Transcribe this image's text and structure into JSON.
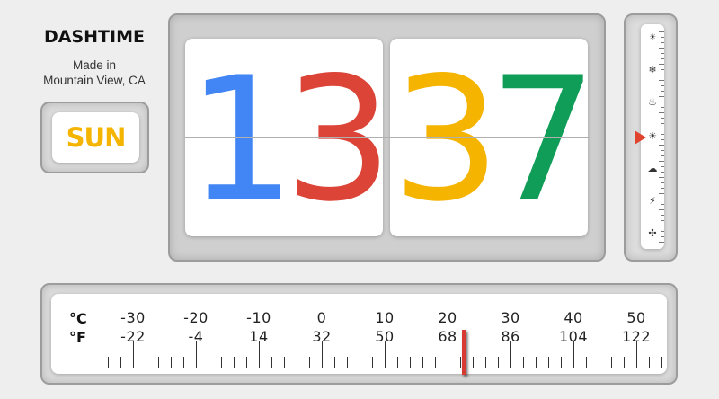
{
  "brand": {
    "title": "DASHTIME",
    "subtitle_line1": "Made in",
    "subtitle_line2": "Mountain View, CA"
  },
  "day": {
    "label": "SUN",
    "color": "#f4b400"
  },
  "clock": {
    "hour": [
      "1",
      "3"
    ],
    "minute": [
      "3",
      "7"
    ],
    "digit_colors": [
      "#4285f4",
      "#db4437",
      "#f4b400",
      "#0f9d58"
    ]
  },
  "weather": {
    "icons": [
      "partly-sunny-icon",
      "snowflake-icon",
      "fire-icon",
      "sun-icon",
      "cloud-icon",
      "lightning-icon",
      "fan-icon"
    ],
    "selected_icon": "sun-icon",
    "pointer_color": "#e0442f"
  },
  "thermometer": {
    "celsius_unit": "°C",
    "fahrenheit_unit": "°F",
    "celsius_labels": [
      "-30",
      "-20",
      "-10",
      "0",
      "10",
      "20",
      "30",
      "40",
      "50"
    ],
    "fahrenheit_labels": [
      "-22",
      "-4",
      "14",
      "32",
      "50",
      "68",
      "86",
      "104",
      "122"
    ],
    "current_celsius": 22.5,
    "needle_color": "#d63a33"
  }
}
